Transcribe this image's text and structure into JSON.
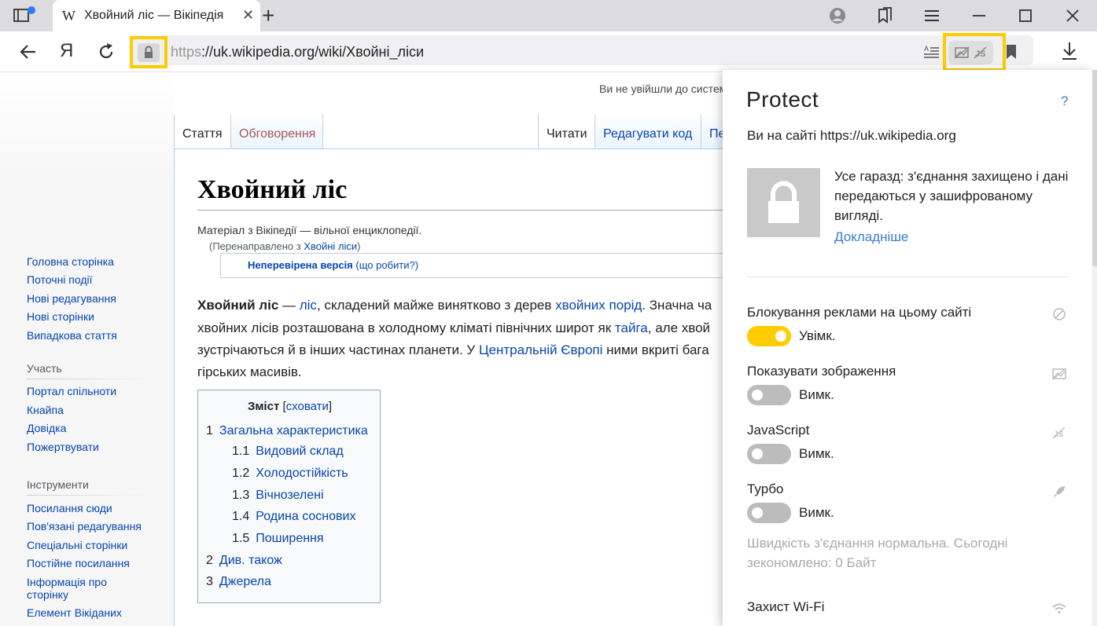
{
  "browser": {
    "tab": {
      "favicon": "W",
      "title": "Хвойний ліс — Вікіпедія",
      "close": "✕"
    },
    "new_tab": "+",
    "address": {
      "ya": "Я",
      "scheme": "https",
      "rest": "://uk.wikipedia.org/wiki/Хвойні_ліси"
    }
  },
  "wiki": {
    "login_note": "Ви не увійшли до системи",
    "tabs": {
      "article": "Стаття",
      "talk": "Обговорення",
      "read": "Читати",
      "edit": "Редагувати код",
      "history": "Переглянути історію"
    },
    "sidebar": {
      "nav": [
        "Головна сторінка",
        "Поточні події",
        "Нові редагування",
        "Нові сторінки",
        "Випадкова стаття"
      ],
      "participation_head": "Участь",
      "participation": [
        "Портал спільноти",
        "Кнайпа",
        "Довідка",
        "Пожертвувати"
      ],
      "tools_head": "Інструменти",
      "tools": [
        "Посилання сюди",
        "Пов'язані редагування",
        "Спеціальні сторінки",
        "Постійне посилання",
        "Інформація про",
        "сторінку",
        "Елемент Вікіданих"
      ]
    },
    "title": "Хвойний ліс",
    "from": "Матеріал з Вікіпедії — вільної енциклопедії.",
    "redirect_pre": "(Перенаправлено з ",
    "redirect_link": "Хвойні ліси",
    "redirect_post": ")",
    "unverified": "Неперевірена версія",
    "unverified_help": "(що робити?)",
    "body": {
      "l1_b": "Хвойний ліс",
      "l1_a": " — ",
      "l1_link1": "ліс",
      "l1_b2": ", складений майже винятково з дерев ",
      "l1_link2": "хвойних порід",
      "l1_c": ". Значна ча",
      "l2_a": "хвойних лісів розташована в холодному кліматі північних широт як ",
      "l2_link": "тайга",
      "l2_b": ", але хвой",
      "l3_a": "зустрічаються й в інших частинах планети. У ",
      "l3_link": "Центральній Європі",
      "l3_b": " ними вкриті бага",
      "l4": "гірських масивів."
    },
    "toc": {
      "title": "Зміст",
      "hide": "сховати",
      "items": [
        {
          "num": "1",
          "text": "Загальна характеристика"
        },
        {
          "num": "1.1",
          "text": "Видовий склад"
        },
        {
          "num": "1.2",
          "text": "Холодостійкість"
        },
        {
          "num": "1.3",
          "text": "Вічнозелені"
        },
        {
          "num": "1.4",
          "text": "Родина соснових"
        },
        {
          "num": "1.5",
          "text": "Поширення"
        },
        {
          "num": "2",
          "text": "Див. також"
        },
        {
          "num": "3",
          "text": "Джерела"
        }
      ]
    }
  },
  "protect": {
    "title": "Protect",
    "help": "?",
    "site": "Ви на сайті https://uk.wikipedia.org",
    "desc": "Усе гаразд: з'єднання захищено і дані передаються у зашифрованому вигляді.",
    "more": "Докладніше",
    "settings": [
      {
        "label": "Блокування реклами на цьому сайті",
        "state": "Увімк.",
        "on": true,
        "icon": "block-icon"
      },
      {
        "label": "Показувати зображення",
        "state": "Вимк.",
        "on": false,
        "icon": "image-off-icon"
      },
      {
        "label": "JavaScript",
        "state": "Вимк.",
        "on": false,
        "icon": "js-off-icon"
      },
      {
        "label": "Турбо",
        "state": "Вимк.",
        "on": false,
        "icon": "rocket-icon"
      }
    ],
    "turbo_note": "Швидкість з'єднання нормальна. Сьогодні зекономлено: 0 Байт",
    "wifi_label": "Захист Wi-Fi"
  },
  "colors": {
    "accent": "#ffcc00",
    "link": "#0645ad",
    "panel_link": "#3a7bd5"
  }
}
